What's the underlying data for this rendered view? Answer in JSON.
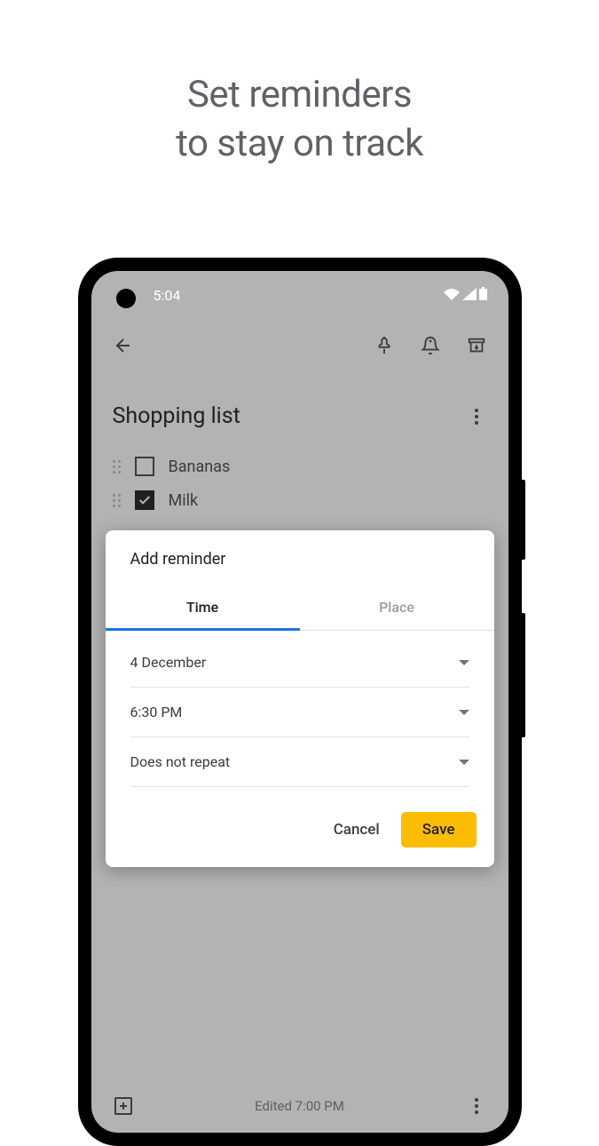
{
  "headline": {
    "line1": "Set reminders",
    "line2": "to stay on track"
  },
  "statusBar": {
    "time": "5:04"
  },
  "note": {
    "title": "Shopping list",
    "items": [
      {
        "text": "Bananas",
        "checked": false
      },
      {
        "text": "Milk",
        "checked": true
      }
    ]
  },
  "dialog": {
    "title": "Add reminder",
    "tabs": [
      {
        "label": "Time",
        "active": true
      },
      {
        "label": "Place",
        "active": false
      }
    ],
    "fields": {
      "date": "4 December",
      "time": "6:30 PM",
      "repeat": "Does not repeat"
    },
    "actions": {
      "cancel": "Cancel",
      "save": "Save"
    }
  },
  "bottomBar": {
    "edited": "Edited 7:00 PM"
  }
}
